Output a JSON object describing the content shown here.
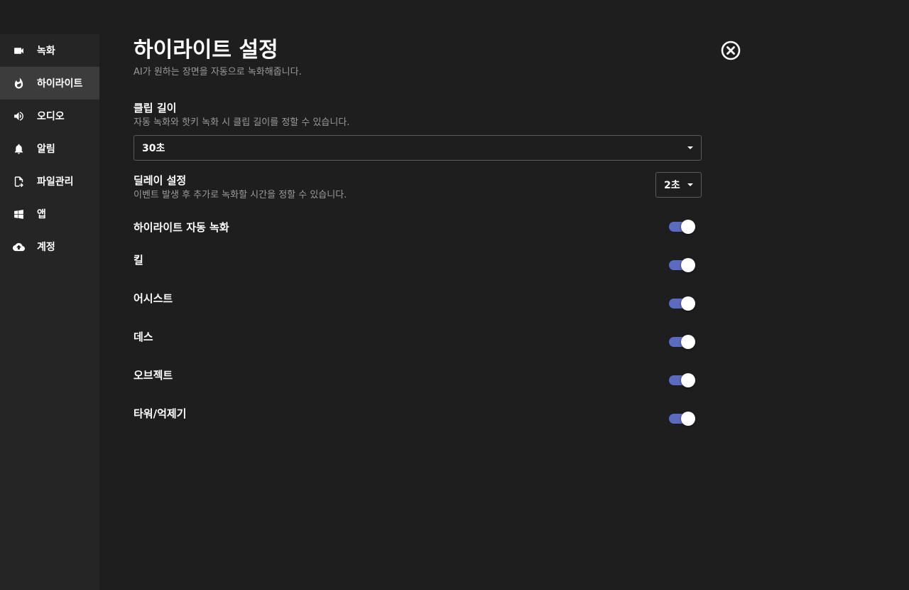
{
  "sidebar": {
    "items": [
      {
        "label": "녹화",
        "icon": "video-camera-icon",
        "active": false
      },
      {
        "label": "하이라이트",
        "icon": "flame-icon",
        "active": true
      },
      {
        "label": "오디오",
        "icon": "speaker-icon",
        "active": false
      },
      {
        "label": "알림",
        "icon": "bell-icon",
        "active": false
      },
      {
        "label": "파일관리",
        "icon": "file-export-icon",
        "active": false
      },
      {
        "label": "앱",
        "icon": "windows-icon",
        "active": false
      },
      {
        "label": "계정",
        "icon": "cloud-upload-icon",
        "active": false
      }
    ]
  },
  "header": {
    "title": "하이라이트 설정",
    "subtitle": "AI가 원하는 장면을 자동으로 녹화해줍니다.",
    "close_icon": "close-circle-icon"
  },
  "clip_length": {
    "title": "클립 길이",
    "description": "자동 녹화와 핫키 녹화 시 클립 길이를 정할 수 있습니다.",
    "value": "30초"
  },
  "delay": {
    "title": "딜레이 설정",
    "description": "이벤트 발생 후 추가로 녹화할 시간을 정할 수 있습니다.",
    "value": "2초"
  },
  "toggles": [
    {
      "label": "하이라이트 자동 녹화",
      "on": true
    },
    {
      "label": "킬",
      "on": true
    },
    {
      "label": "어시스트",
      "on": true
    },
    {
      "label": "데스",
      "on": true
    },
    {
      "label": "오브젝트",
      "on": true
    },
    {
      "label": "타워/억제기",
      "on": true
    }
  ],
  "colors": {
    "background": "#1e1e1e",
    "sidebar": "#252525",
    "sidebar_active": "#3c3c3c",
    "toggle_accent": "#5c6bc0",
    "muted_text": "#9a9a9a"
  }
}
